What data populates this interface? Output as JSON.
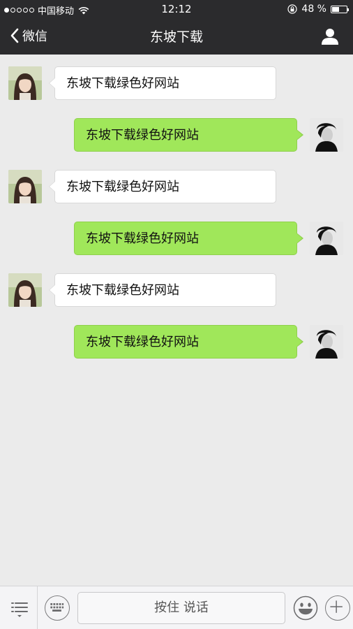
{
  "status_bar": {
    "carrier": "中国移动",
    "signal_dots_filled": 1,
    "signal_dots_total": 5,
    "time": "12:12",
    "battery_percent": "48 %",
    "battery_level": 0.48
  },
  "nav": {
    "back_label": "微信",
    "title": "东坡下载"
  },
  "messages": [
    {
      "direction": "in",
      "text": "东坡下载绿色好网站"
    },
    {
      "direction": "out",
      "text": "东坡下载绿色好网站"
    },
    {
      "direction": "in",
      "text": "东坡下载绿色好网站"
    },
    {
      "direction": "out",
      "text": "东坡下载绿色好网站"
    },
    {
      "direction": "in",
      "text": "东坡下载绿色好网站"
    },
    {
      "direction": "out",
      "text": "东坡下载绿色好网站"
    }
  ],
  "input_bar": {
    "talk_label": "按住 说话"
  },
  "colors": {
    "header_bg": "#2b2b2d",
    "chat_bg": "#ebebeb",
    "outgoing_bubble": "#a0e75a",
    "incoming_bubble": "#ffffff"
  },
  "icons": {
    "back": "chevron-left-icon",
    "profile": "person-icon",
    "menu": "menu-list-icon",
    "keyboard": "keyboard-icon",
    "emoji": "smiley-icon",
    "plus": "plus-icon",
    "wifi": "wifi-icon",
    "lock": "orientation-lock-icon",
    "battery": "battery-icon"
  }
}
